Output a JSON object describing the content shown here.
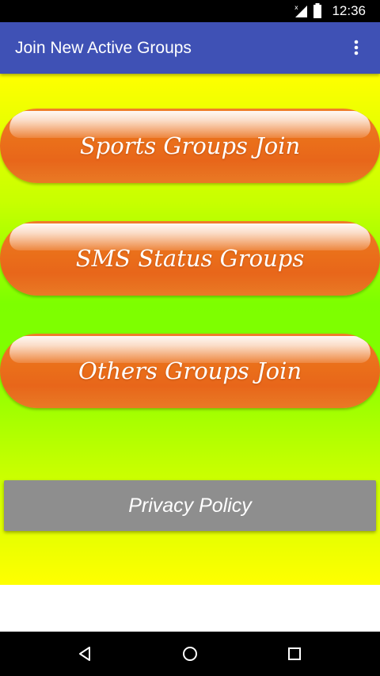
{
  "status_bar": {
    "time": "12:36",
    "icons": [
      "signal-icon",
      "battery-icon"
    ]
  },
  "app_bar": {
    "title": "Join New Active Groups",
    "menu_icon": "more-vert-icon",
    "color": "#3f51b5"
  },
  "buttons": [
    {
      "label": "Sports Groups Join"
    },
    {
      "label": "SMS Status Groups"
    },
    {
      "label": "Others Groups Join"
    }
  ],
  "privacy": {
    "label": "Privacy Policy"
  },
  "nav_bar": {
    "icons": [
      "back-icon",
      "home-icon",
      "recents-icon"
    ]
  },
  "colors": {
    "button_orange": "#ea6f1a",
    "background_top": "#ffff00",
    "background_mid": "#7dff00",
    "privacy_gray": "#8e8e8e"
  }
}
